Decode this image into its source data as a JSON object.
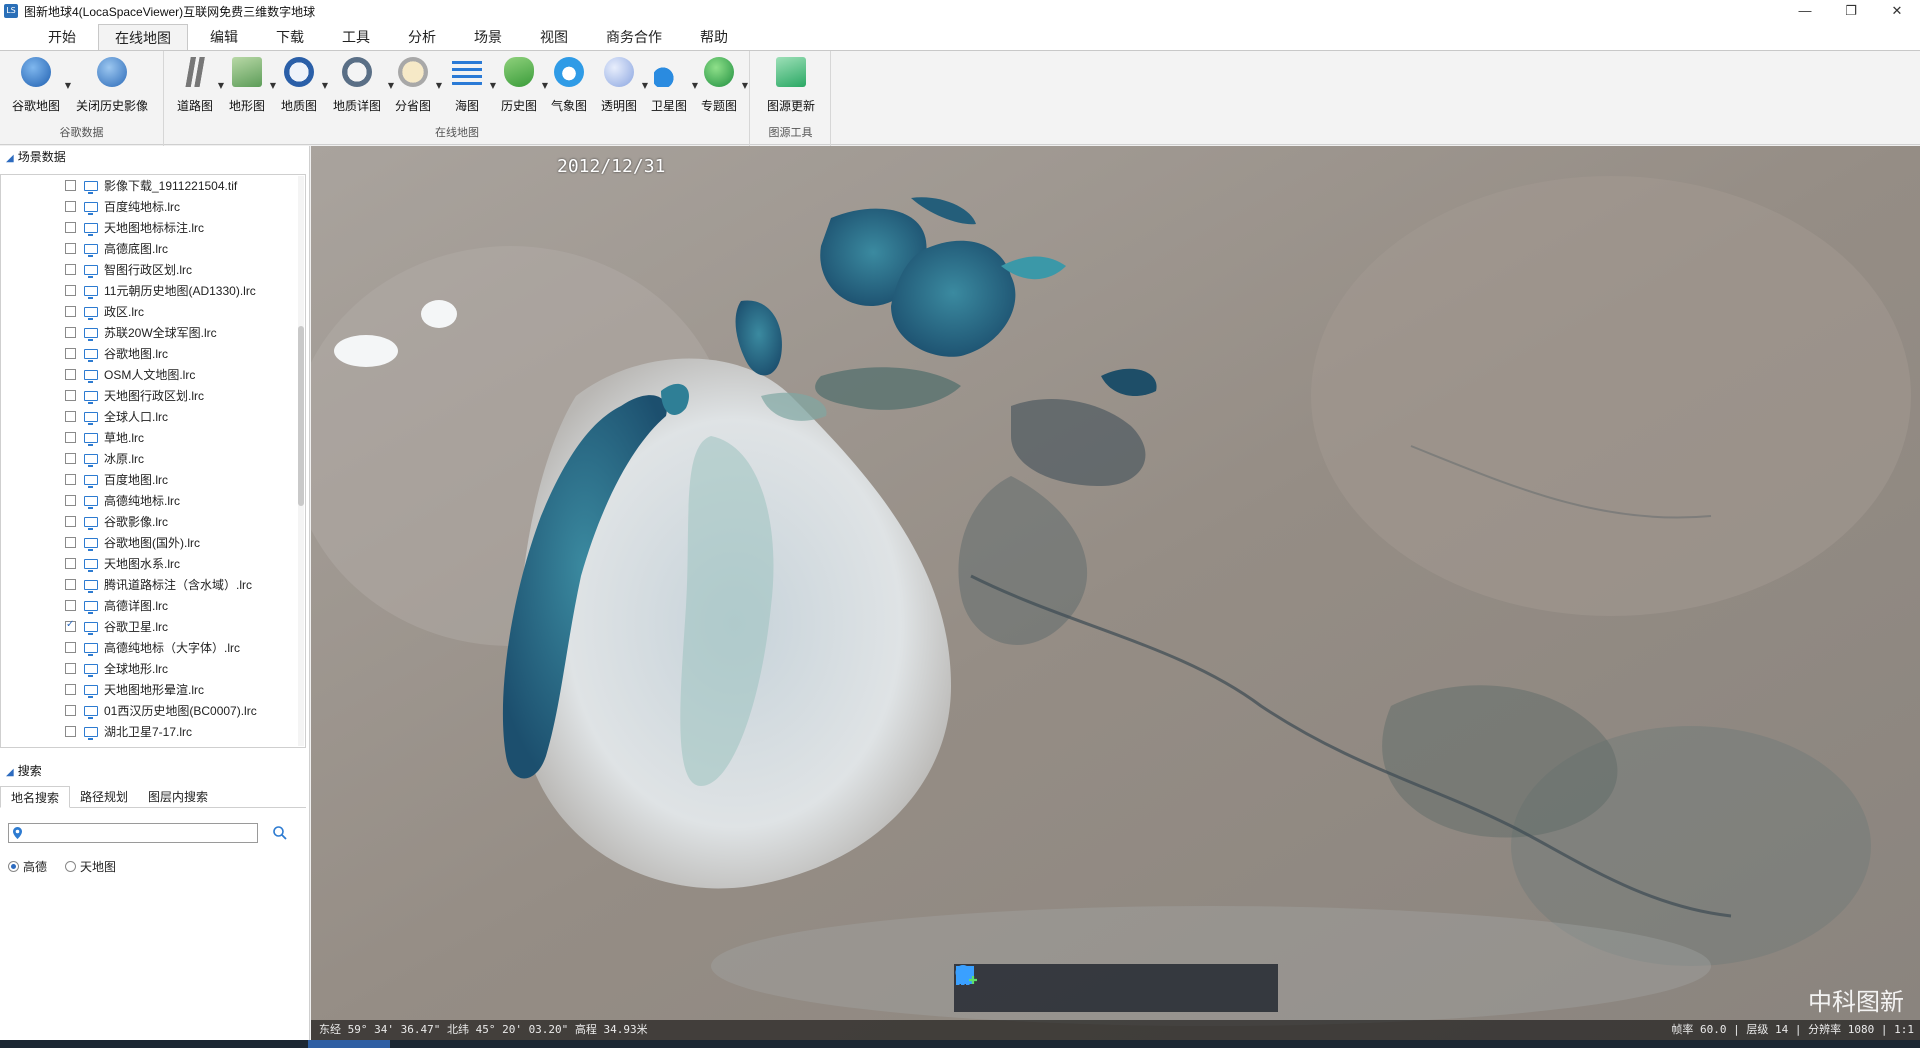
{
  "window": {
    "title": "图新地球4(LocaSpaceViewer)互联网免费三维数字地球",
    "controls": [
      "—",
      "❐",
      "✕"
    ]
  },
  "menu": {
    "tabs": [
      "开始",
      "在线地图",
      "编辑",
      "下载",
      "工具",
      "分析",
      "场景",
      "视图",
      "商务合作",
      "帮助"
    ],
    "active": "在线地图"
  },
  "ribbon": {
    "groups": [
      {
        "label": "谷歌数据",
        "buttons": [
          "谷歌地图",
          "关闭历史影像"
        ]
      },
      {
        "label": "在线地图",
        "buttons": [
          "道路图",
          "地形图",
          "地质图",
          "地质详图",
          "分省图",
          "海图",
          "历史图",
          "气象图",
          "透明图",
          "卫星图",
          "专题图"
        ]
      },
      {
        "label": "图源工具",
        "buttons": [
          "图源更新"
        ]
      }
    ]
  },
  "scene_panel": {
    "title": "场景数据",
    "layers": [
      {
        "name": "影像下载_1911221504.tif",
        "checked": false
      },
      {
        "name": "百度纯地标.lrc",
        "checked": false
      },
      {
        "name": "天地图地标标注.lrc",
        "checked": false
      },
      {
        "name": "高德底图.lrc",
        "checked": false
      },
      {
        "name": "智图行政区划.lrc",
        "checked": false
      },
      {
        "name": "11元朝历史地图(AD1330).lrc",
        "checked": false
      },
      {
        "name": "政区.lrc",
        "checked": false
      },
      {
        "name": "苏联20W全球军图.lrc",
        "checked": false
      },
      {
        "name": "谷歌地图.lrc",
        "checked": false
      },
      {
        "name": "OSM人文地图.lrc",
        "checked": false
      },
      {
        "name": "天地图行政区划.lrc",
        "checked": false
      },
      {
        "name": "全球人口.lrc",
        "checked": false
      },
      {
        "name": "草地.lrc",
        "checked": false
      },
      {
        "name": "冰原.lrc",
        "checked": false
      },
      {
        "name": "百度地图.lrc",
        "checked": false
      },
      {
        "name": "高德纯地标.lrc",
        "checked": false
      },
      {
        "name": "谷歌影像.lrc",
        "checked": false
      },
      {
        "name": "谷歌地图(国外).lrc",
        "checked": false
      },
      {
        "name": "天地图水系.lrc",
        "checked": false
      },
      {
        "name": "腾讯道路标注（含水域）.lrc",
        "checked": false
      },
      {
        "name": "高德详图.lrc",
        "checked": false
      },
      {
        "name": "谷歌卫星.lrc",
        "checked": true
      },
      {
        "name": "高德纯地标（大字体）.lrc",
        "checked": false
      },
      {
        "name": "全球地形.lrc",
        "checked": false
      },
      {
        "name": "天地图地形晕渲.lrc",
        "checked": false
      },
      {
        "name": "01西汉历史地图(BC0007).lrc",
        "checked": false
      },
      {
        "name": "湖北卫星7-17.lrc",
        "checked": false
      }
    ]
  },
  "search_panel": {
    "title": "搜索",
    "tabs": [
      "地名搜索",
      "路径规划",
      "图层内搜索"
    ],
    "active_tab": "地名搜索",
    "input_value": "",
    "input_placeholder": "",
    "sources": [
      {
        "label": "高德",
        "selected": true
      },
      {
        "label": "天地图",
        "selected": false
      }
    ]
  },
  "map": {
    "date": "2012/12/31",
    "watermark": "中科图新",
    "status_left": "东经 59° 34' 36.47\" 北纬 45° 20' 03.20\"  高程 34.93米",
    "status_right": "帧率 60.0 | 层级 14 | 分辨率 1080 | 1:1",
    "tools": [
      "hand-icon",
      "pointer-icon",
      "placemark-icon",
      "line-icon",
      "polygon-icon",
      "chart-add-icon"
    ]
  },
  "colors": {
    "accent": "#2d6bbf",
    "water_dark": "#1c4f6e",
    "water_teal": "#2f8397",
    "salt": "#d9dde0",
    "land": "#8f8780"
  }
}
